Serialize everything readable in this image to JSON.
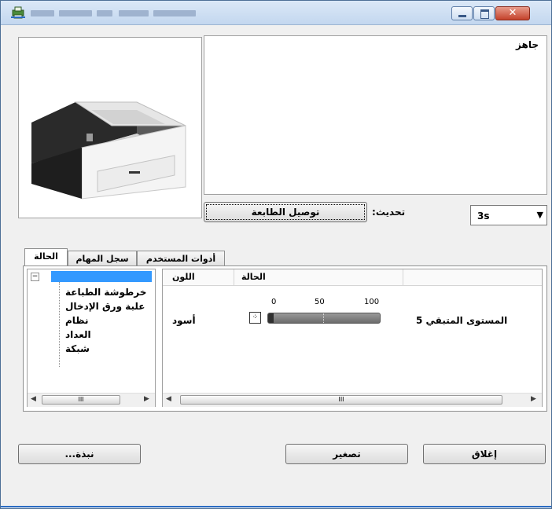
{
  "window": {
    "title_blurred": true
  },
  "status": {
    "message": "جاهز"
  },
  "toolbar": {
    "connect_label": "توصيل الطابعة",
    "refresh_label": ":تحديث",
    "refresh_value": "3s"
  },
  "tabs": [
    {
      "label": "الحالة",
      "active": true
    },
    {
      "label": "سجل المهام",
      "active": false
    },
    {
      "label": "أدوات المستخدم",
      "active": false
    }
  ],
  "tree": {
    "items": [
      {
        "label": "خرطوشة الطباعة"
      },
      {
        "label": "علبة ورق الإدخال"
      },
      {
        "label": "نظام"
      },
      {
        "label": "العداد"
      },
      {
        "label": "شبكة"
      }
    ]
  },
  "list": {
    "headers": {
      "color": "اللون",
      "status": "الحالة"
    },
    "rows": [
      {
        "color": "أسود",
        "level_label": "المستوى المتبقي 5",
        "level_fraction": 0.05,
        "scale": [
          "0",
          "50",
          "100"
        ]
      }
    ]
  },
  "scroll": {
    "thumb_glyph": "III"
  },
  "buttons": {
    "close": "إغلاق",
    "minimize": "تصغير",
    "about": "...نبذة"
  },
  "colors": {
    "title_bg": "#c3d7ef",
    "close_red": "#c4422b",
    "selection_blue": "#3399ff"
  }
}
